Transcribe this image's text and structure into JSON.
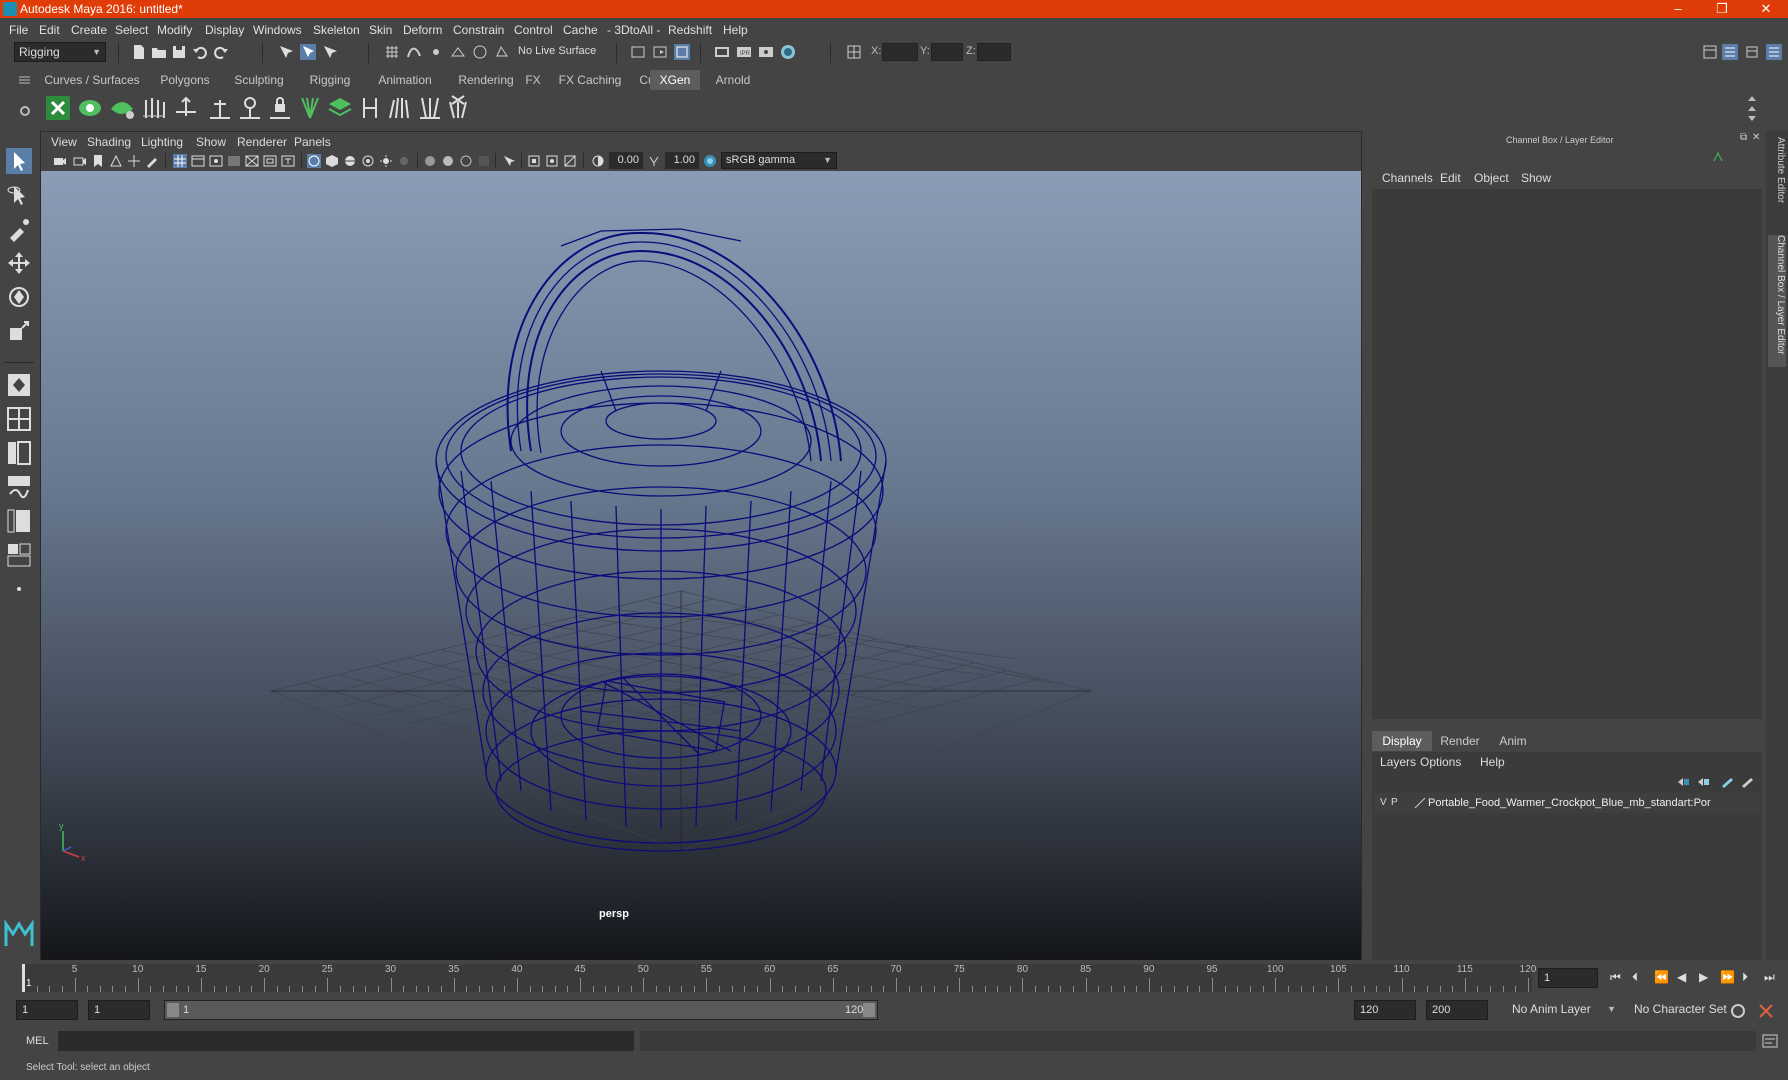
{
  "window": {
    "title": "Autodesk Maya 2016: untitled*",
    "controls": [
      "–",
      "❐",
      "✕"
    ]
  },
  "menubar": [
    "File",
    "Edit",
    "Create",
    "Select",
    "Modify",
    "Display",
    "Windows",
    "Skeleton",
    "Skin",
    "Deform",
    "Constrain",
    "Control",
    "Cache",
    "- 3DtoAll -",
    "Redshift",
    "Help"
  ],
  "statusline": {
    "menuset": "Rigging",
    "live_surface": "No Live Surface",
    "x_label": "X:",
    "y_label": "Y:",
    "z_label": "Z:"
  },
  "shelf": {
    "tabs": [
      "Curves / Surfaces",
      "Polygons",
      "Sculpting",
      "Rigging",
      "Animation",
      "Rendering",
      "FX",
      "FX Caching",
      "Custom",
      "XGen",
      "Arnold"
    ],
    "active_tab": "XGen"
  },
  "viewport": {
    "menu": [
      "View",
      "Shading",
      "Lighting",
      "Show",
      "Renderer",
      "Panels"
    ],
    "exposure": "0.00",
    "gamma": "1.00",
    "color_space": "sRGB gamma",
    "camera_label": "persp"
  },
  "channel_box": {
    "title": "Channel Box / Layer Editor",
    "menu": [
      "Channels",
      "Edit",
      "Object",
      "Show"
    ],
    "side_tabs": [
      "Attribute Editor",
      "Channel Box / Layer Editor"
    ]
  },
  "layer_editor": {
    "tabs": [
      "Display",
      "Render",
      "Anim"
    ],
    "active_tab": "Display",
    "menu": [
      "Layers",
      "Options",
      "Help"
    ],
    "layers": [
      {
        "v": "V",
        "p": "P",
        "name": "Portable_Food_Warmer_Crockpot_Blue_mb_standart:Por"
      }
    ]
  },
  "timeline": {
    "ticks": [
      "5",
      "10",
      "15",
      "20",
      "25",
      "30",
      "35",
      "40",
      "45",
      "50",
      "55",
      "60",
      "65",
      "70",
      "75",
      "80",
      "85",
      "90",
      "95",
      "100",
      "105",
      "110",
      "115",
      "120"
    ],
    "start_label": "1",
    "current_frame": "1"
  },
  "range": {
    "start": "1",
    "playback_start": "1",
    "slider_start": "1",
    "slider_end": "120",
    "playback_end": "120",
    "end": "200",
    "anim_layer": "No Anim Layer",
    "character_set": "No Character Set"
  },
  "command_line": {
    "label": "MEL"
  },
  "help_line": "Select Tool: select an object",
  "colors": {
    "title_bar": "#e03c07",
    "wireframe": "#0b0b7a",
    "active_tab": "#5d5d5d"
  }
}
